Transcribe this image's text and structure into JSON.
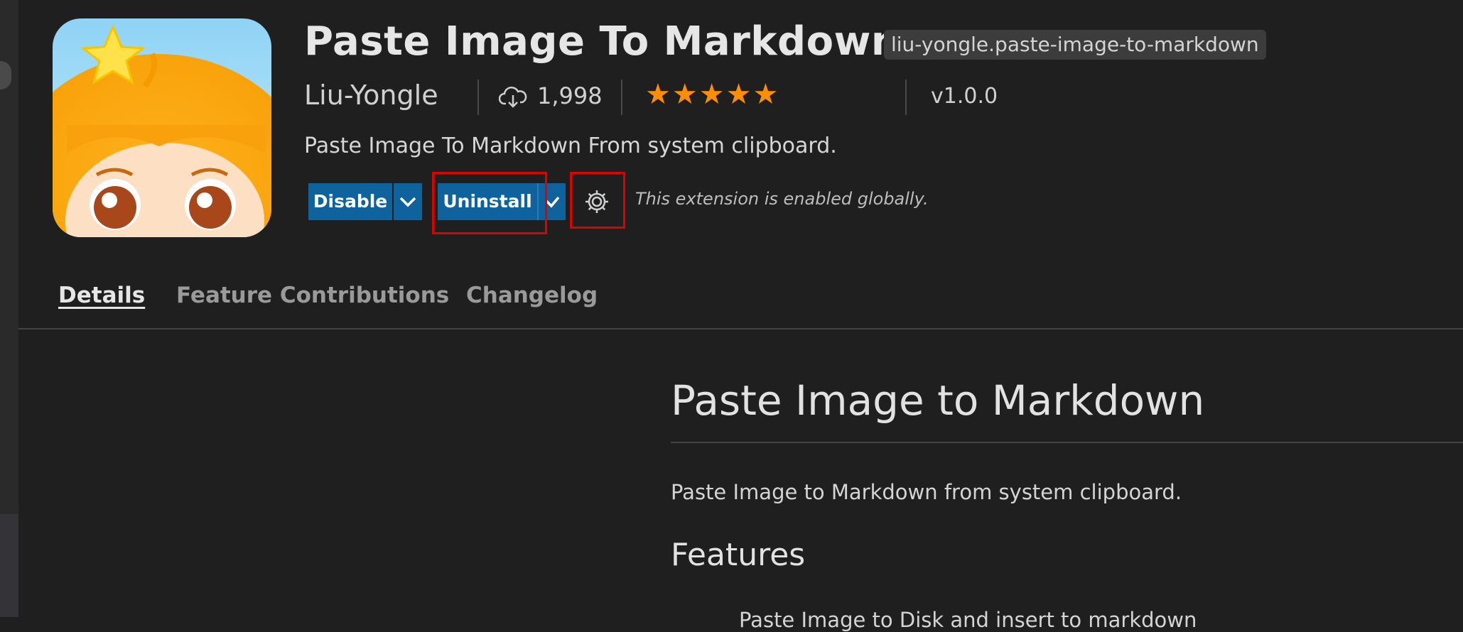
{
  "extension": {
    "title": "Paste Image To Markdown.",
    "id": "liu-yongle.paste-image-to-markdown",
    "publisher": "Liu-Yongle",
    "installs": "1,998",
    "rating": "★★★★★",
    "version": "v1.0.0",
    "description": "Paste Image To Markdown From system clipboard.",
    "icon": "monkey-character-icon"
  },
  "actions": {
    "disable_label": "Disable",
    "uninstall_label": "Uninstall",
    "status_text": "This extension is enabled globally.",
    "colors": {
      "button": "#0e639c",
      "highlight": "#e00000",
      "stars": "#ff8e00"
    }
  },
  "tabs": [
    {
      "label": "Details"
    },
    {
      "label": "Feature Contributions"
    },
    {
      "label": "Changelog"
    }
  ],
  "readme": {
    "heading": "Paste Image to Markdown",
    "intro": "Paste Image to Markdown from system clipboard.",
    "features_heading": "Features",
    "first_item": "Paste Image to Disk and insert to markdown"
  }
}
